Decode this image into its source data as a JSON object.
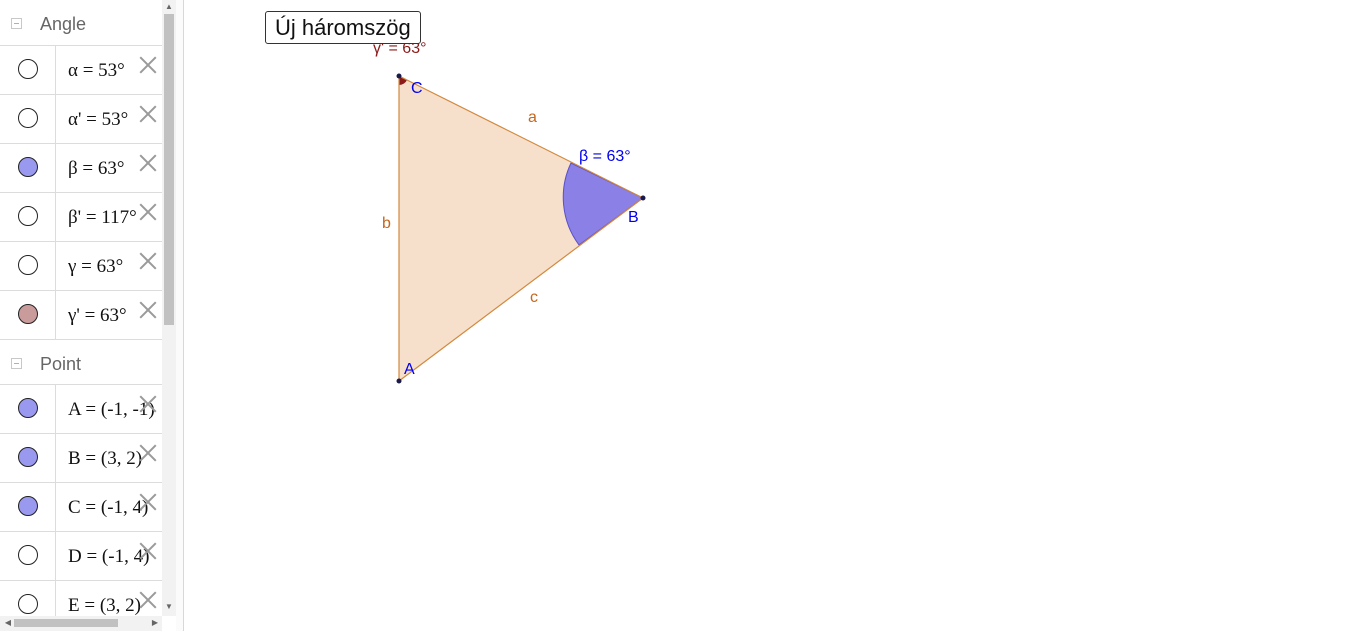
{
  "sidebar": {
    "groups": [
      {
        "label": "Angle",
        "rows": [
          {
            "text": "α = 53°",
            "marble": "#ffffff"
          },
          {
            "text": "α' = 53°",
            "marble": "#ffffff"
          },
          {
            "text": "β = 63°",
            "marble": "#9a99f0"
          },
          {
            "text": "β' = 117°",
            "marble": "#ffffff"
          },
          {
            "text": "γ = 63°",
            "marble": "#ffffff"
          },
          {
            "text": "γ' = 63°",
            "marble": "#c99b9b"
          }
        ]
      },
      {
        "label": "Point",
        "rows": [
          {
            "text": "A = (-1, -1)",
            "marble": "#9a99f0"
          },
          {
            "text": "B = (3, 2)",
            "marble": "#9a99f0"
          },
          {
            "text": "C = (-1, 4)",
            "marble": "#9a99f0"
          },
          {
            "text": "D = (-1, 4)",
            "marble": "#ffffff"
          },
          {
            "text": "E = (3, 2)",
            "marble": "#ffffff"
          }
        ]
      }
    ]
  },
  "graphics": {
    "button_label": "Új háromszög",
    "labels": {
      "gamma_label": "γ' = 63°",
      "point_A": "A",
      "point_B": "B",
      "point_C": "C",
      "side_a": "a",
      "side_b": "b",
      "side_c": "c",
      "beta_label": "β = 63°"
    },
    "colors": {
      "triangle_fill": "#f6e0cc",
      "triangle_edge": "#d2893e",
      "side_label": "#c8661a",
      "point_label": "#0000ee",
      "angle_fill": "#8a80e6",
      "gamma_color": "#8b1a1a",
      "point_dot": "#1a1a4a"
    }
  }
}
